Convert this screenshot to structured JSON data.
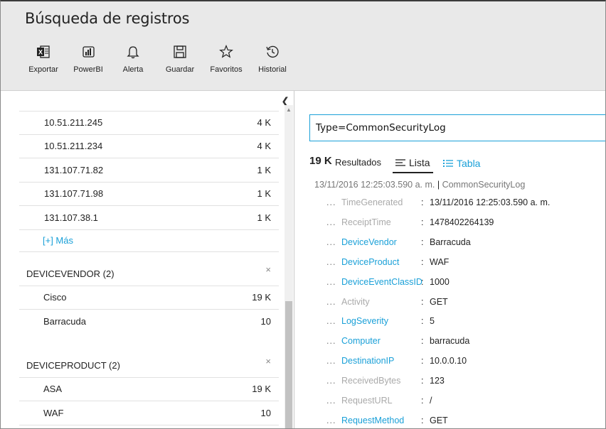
{
  "header": {
    "title": "Búsqueda de registros",
    "toolbar": [
      {
        "label": "Exportar",
        "icon": "excel-icon"
      },
      {
        "label": "PowerBI",
        "icon": "powerbi-icon"
      },
      {
        "label": "Alerta",
        "icon": "bell-icon"
      },
      {
        "label": "Guardar",
        "icon": "save-icon"
      },
      {
        "label": "Favoritos",
        "icon": "star-icon"
      },
      {
        "label": "Historial",
        "icon": "history-icon"
      }
    ]
  },
  "left": {
    "ip_rows": [
      {
        "key": "10.51.211.245",
        "count": "4 K"
      },
      {
        "key": "10.51.211.234",
        "count": "4 K"
      },
      {
        "key": "131.107.71.82",
        "count": "1 K"
      },
      {
        "key": "131.107.71.98",
        "count": "1 K"
      },
      {
        "key": "131.107.38.1",
        "count": "1 K"
      }
    ],
    "more_label": "[+] Más",
    "groups": [
      {
        "title": "DEVICEVENDOR  (2)",
        "close": "×",
        "rows": [
          {
            "key": "Cisco",
            "count": "19 K"
          },
          {
            "key": "Barracuda",
            "count": "10"
          }
        ]
      },
      {
        "title": "DEVICEPRODUCT  (2)",
        "close": "×",
        "rows": [
          {
            "key": "ASA",
            "count": "19 K"
          },
          {
            "key": "WAF",
            "count": "10"
          }
        ]
      }
    ]
  },
  "right": {
    "query": "Type=CommonSecurityLog",
    "count": "19 K",
    "count_label": "Resultados",
    "tabs": {
      "lista": "Lista",
      "tabla": "Tabla"
    },
    "record_time": "13/11/2016 12:25:03.590 a. m.",
    "record_sep": " | ",
    "record_source": "CommonSecurityLog",
    "fields": [
      {
        "name": "TimeGenerated",
        "value": "13/11/2016  12:25:03.590 a. m.",
        "link": false
      },
      {
        "name": "ReceiptTime",
        "value": "1478402264139",
        "link": false
      },
      {
        "name": "DeviceVendor",
        "value": "Barracuda",
        "link": true
      },
      {
        "name": "DeviceProduct",
        "value": "WAF",
        "link": true
      },
      {
        "name": "DeviceEventClassID",
        "value": "1000",
        "link": true
      },
      {
        "name": "Activity",
        "value": "GET",
        "link": false
      },
      {
        "name": "LogSeverity",
        "value": "5",
        "link": true
      },
      {
        "name": "Computer",
        "value": "barracuda",
        "link": true
      },
      {
        "name": "DestinationIP",
        "value": "10.0.0.10",
        "link": true
      },
      {
        "name": "ReceivedBytes",
        "value": "123",
        "link": false
      },
      {
        "name": "RequestURL",
        "value": "/",
        "link": false
      },
      {
        "name": "RequestMethod",
        "value": "GET",
        "link": true
      }
    ],
    "dots": "...",
    "colon": ":"
  },
  "colors": {
    "accent": "#1aa0d8",
    "header_bg": "#e9e9e9"
  }
}
